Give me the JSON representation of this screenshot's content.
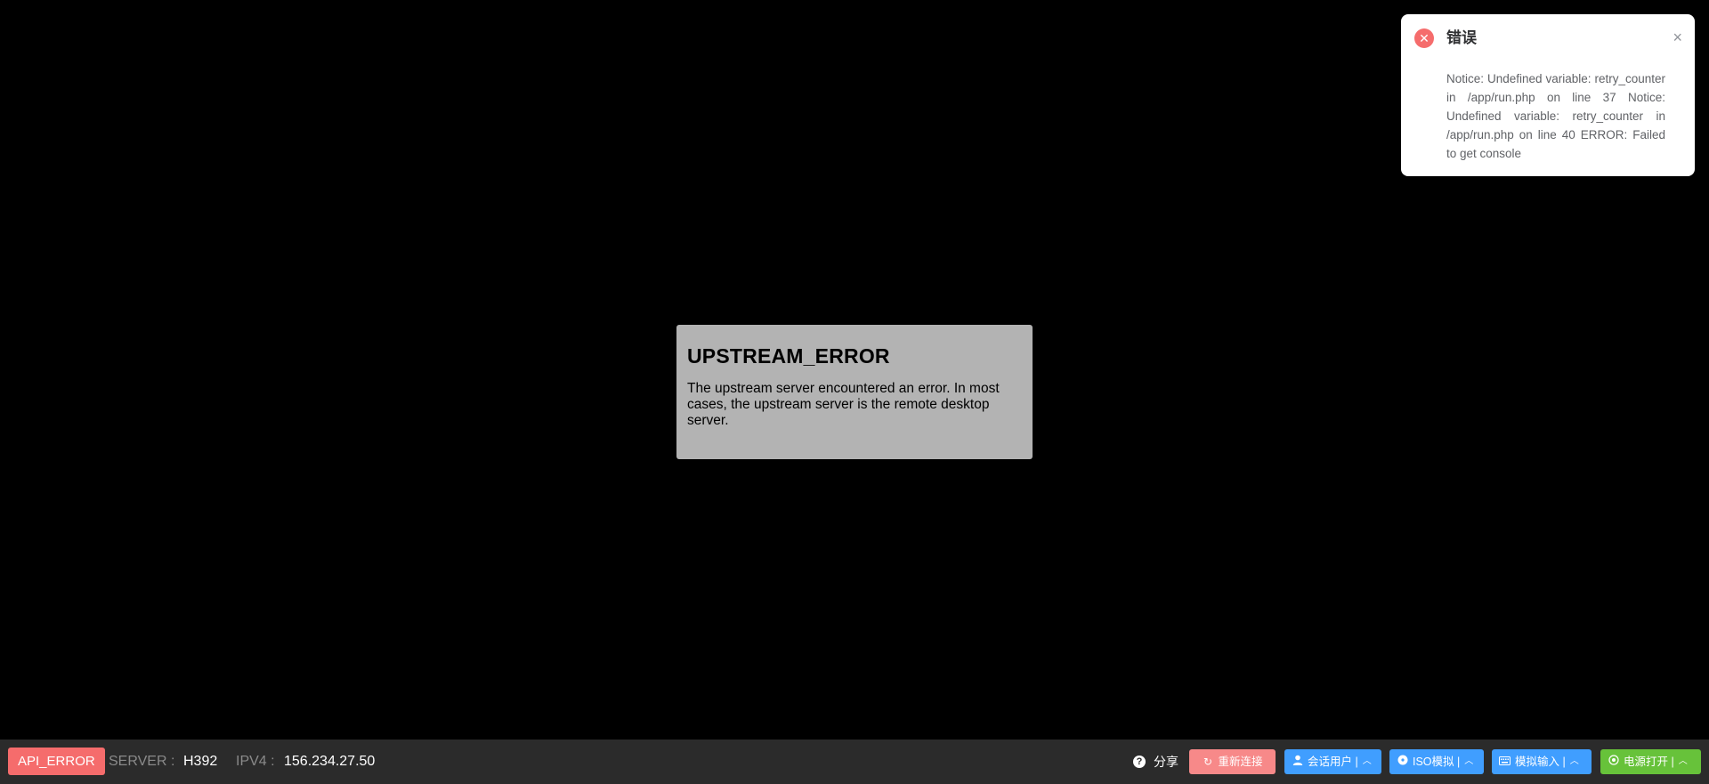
{
  "error_dialog": {
    "title": "UPSTREAM_ERROR",
    "message": "The upstream server encountered an error. In most cases, the upstream server is the remote desktop server."
  },
  "notification": {
    "title": "错误",
    "close_icon": "×",
    "error_icon": "✕",
    "message": "Notice: Undefined variable: retry_counter in /app/run.php on line 37 Notice: Undefined variable: retry_counter in /app/run.php on line 40 ERROR: Failed to get console"
  },
  "bottom_bar": {
    "status": "API_ERROR",
    "server_label": "SERVER :",
    "server_value": "H392",
    "ipv4_label": "IPV4 :",
    "ipv4_value": "156.234.27.50",
    "share_label": "分享",
    "buttons": {
      "reconnect": "重新连接",
      "session_user": "会话用户 |",
      "iso_mount": "ISO模拟 |",
      "simulated_input": "模拟输入 |",
      "power_on": "电源打开 |"
    }
  },
  "colors": {
    "error": "#f56c6c",
    "primary": "#409eff",
    "success": "#67c23a",
    "bar_bg": "#2b2b2b"
  }
}
